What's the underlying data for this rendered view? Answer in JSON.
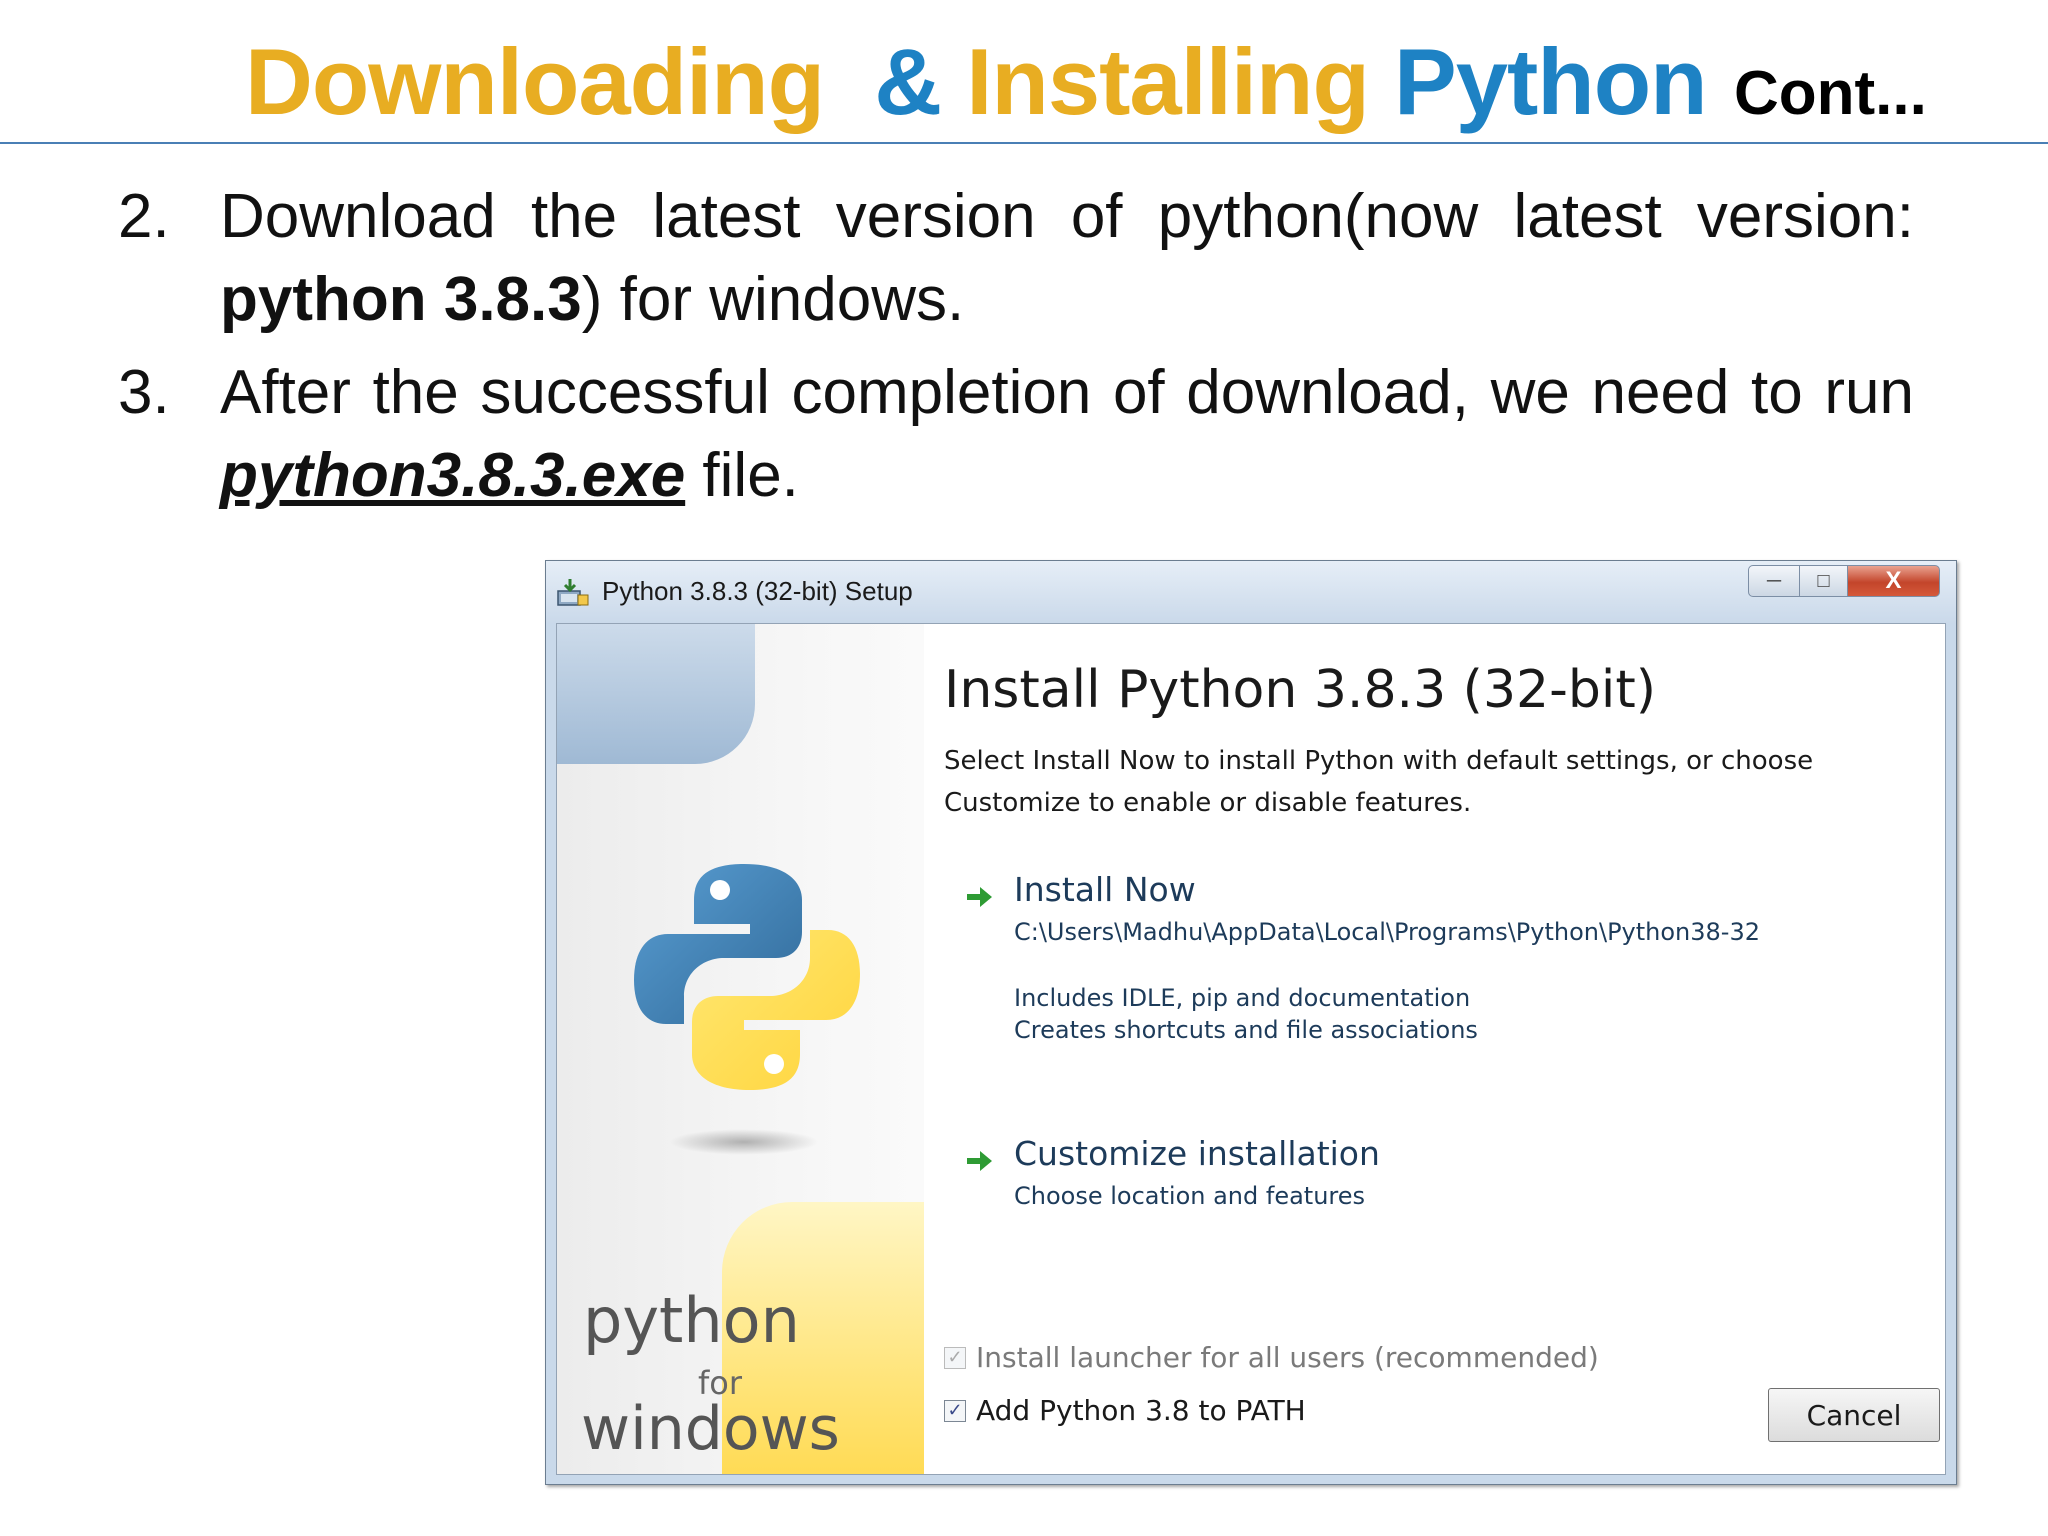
{
  "slide": {
    "title_part1": "Downloading",
    "title_amp": "&",
    "title_part2": "Installing",
    "title_part3": "Python",
    "title_cont": "Cont...",
    "steps": [
      {
        "number": "2.",
        "text_a": "Download the latest version of python(now latest version: ",
        "text_bold": "python 3.8.3",
        "text_b": ") for windows."
      },
      {
        "number": "3.",
        "text_a": "After the successful completion of download, we need to run ",
        "text_emph": "python3.8.3.exe",
        "text_b": " file."
      }
    ],
    "colors": {
      "gold": "#e8ad22",
      "blue": "#1e82c4"
    }
  },
  "dialog": {
    "window_title": "Python 3.8.3 (32-bit) Setup",
    "window_icon": "installer-icon",
    "close_glyph": "X",
    "heading": "Install Python 3.8.3 (32-bit)",
    "description_line1": "Select Install Now to install Python with default settings, or choose",
    "description_line2": "Customize to enable or disable features.",
    "install_now": {
      "title": "Install Now",
      "path": "C:\\Users\\Madhu\\AppData\\Local\\Programs\\Python\\Python38-32",
      "note1": "Includes IDLE, pip and documentation",
      "note2": "Creates shortcuts and file associations"
    },
    "customize": {
      "title": "Customize installation",
      "subtitle": "Choose location and features"
    },
    "checkbox_launcher": {
      "label": "Install launcher for all users (recommended)",
      "checked": true,
      "enabled": false
    },
    "checkbox_path": {
      "label": "Add Python 3.8 to PATH",
      "checked": true,
      "enabled": true
    },
    "cancel_label": "Cancel",
    "brand_python": "python",
    "brand_for": "for",
    "brand_windows": "windows"
  }
}
